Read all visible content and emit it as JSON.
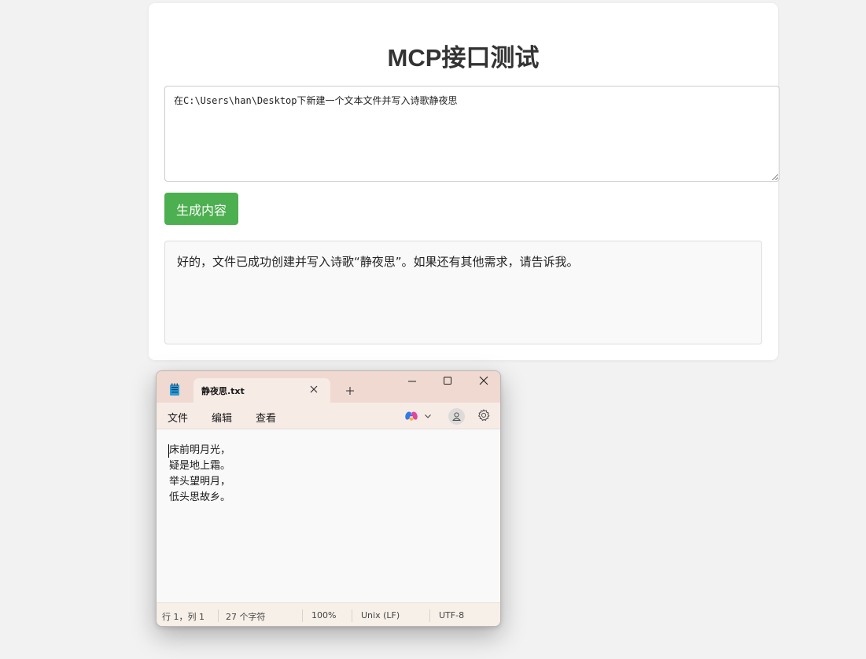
{
  "page": {
    "title": "MCP接口测试",
    "prompt_value": "在C:\\Users\\han\\Desktop下新建一个文本文件并写入诗歌静夜思",
    "generate_button": "生成内容",
    "result_text": "好的，文件已成功创建并写入诗歌“静夜思”。如果还有其他需求，请告诉我。",
    "accent_color": "#4caf50"
  },
  "notepad": {
    "tab_title": "静夜思.txt",
    "menu": [
      "文件",
      "编辑",
      "查看"
    ],
    "lines": [
      "床前明月光，",
      "疑是地上霜。",
      "举头望明月，",
      "低头思故乡。"
    ],
    "status": {
      "position": "行 1，列 1",
      "chars": "27 个字符",
      "zoom": "100%",
      "line_ending": "Unix (LF)",
      "encoding": "UTF-8"
    },
    "icons": [
      "notepad-app-icon",
      "close-icon",
      "plus-icon",
      "minimize-icon",
      "maximize-icon",
      "window-close-icon",
      "copilot-icon",
      "chevron-down-icon",
      "account-icon",
      "gear-icon"
    ]
  }
}
